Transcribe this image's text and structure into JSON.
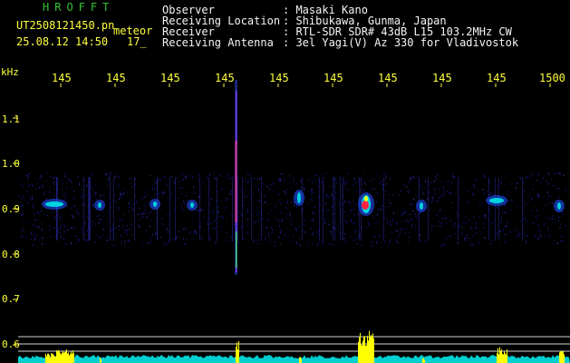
{
  "app": {
    "title": "HROFFT",
    "filename": "UT2508121450.pn",
    "mode": "meteor",
    "datetime": "25.08.12 14:50",
    "count": "17_"
  },
  "station": {
    "observer_label": "Observer",
    "observer_value": ": Masaki Kano",
    "location_label": "Receiving Location",
    "location_value": ": Shibukawa, Gunma, Japan",
    "receiver_label": "Receiver",
    "receiver_value": ": RTL-SDR SDR# 43dB L15 103.2MHz CW",
    "antenna_label": "Receiving Antenna",
    "antenna_value": ": 3el Yagi(V) Az 330 for Vladivostok"
  },
  "axis": {
    "y_unit": "kHz",
    "y_ticks": [
      "1.1",
      "1.0",
      "0.9",
      "0.8",
      "0.7",
      "0.6"
    ],
    "time_labels": [
      "145",
      "145",
      "145",
      "145",
      "145",
      "145",
      "145",
      "145",
      "145",
      "1500"
    ]
  },
  "colors": {
    "background": "#000000",
    "text": "#f5f5f5",
    "title_green": "#34c234",
    "axis_yellow": "#ffff3c",
    "noise_blue": "#1a1a9a",
    "level_cyan": "#00e6e6",
    "peak_yellow": "#ffff00",
    "echo_red": "#ff2040"
  }
}
